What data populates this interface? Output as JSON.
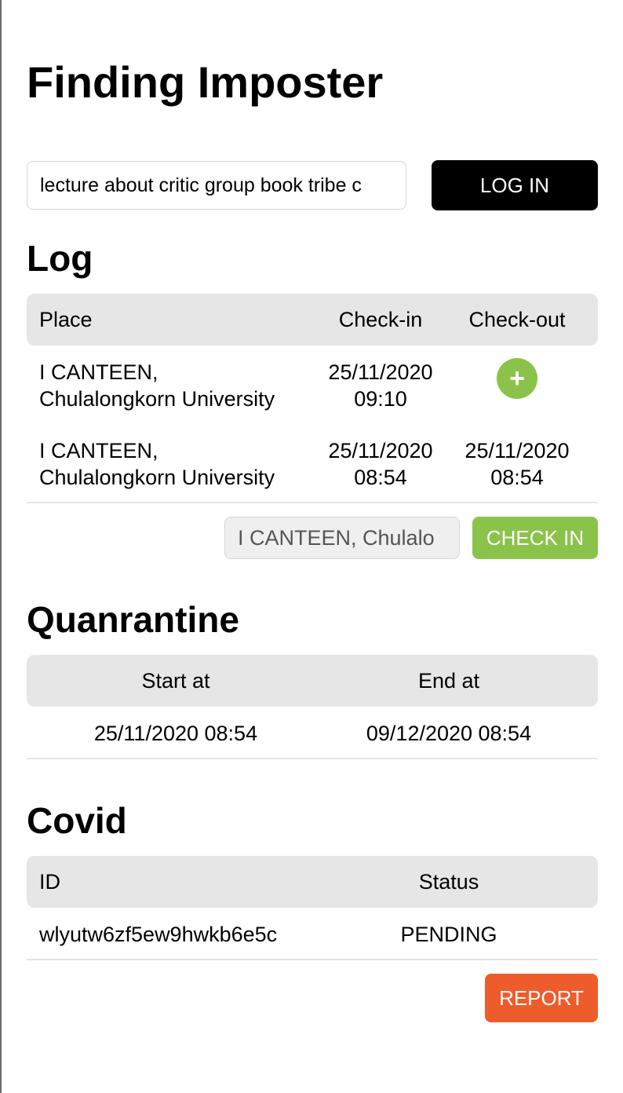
{
  "app": {
    "title": "Finding Imposter"
  },
  "login": {
    "token_value": "lecture about critic group book tribe c",
    "button_label": "LOG IN"
  },
  "log": {
    "title": "Log",
    "columns": [
      "Place",
      "Check-in",
      "Check-out"
    ],
    "rows": [
      {
        "place_line1": "I CANTEEN,",
        "place_line2": "Chulalongkorn University",
        "checkin_date": "25/11/2020",
        "checkin_time": "09:10",
        "checkout_action": "+"
      },
      {
        "place_line1": "I CANTEEN,",
        "place_line2": "Chulalongkorn University",
        "checkin_date": "25/11/2020",
        "checkin_time": "08:54",
        "checkout_date": "25/11/2020",
        "checkout_time": "08:54"
      }
    ],
    "place_input_value": "I CANTEEN, Chulalo",
    "checkin_button_label": "CHECK IN"
  },
  "quarantine": {
    "title": "Quanrantine",
    "columns": [
      "Start at",
      "End at"
    ],
    "rows": [
      {
        "start": "25/11/2020 08:54",
        "end": "09/12/2020 08:54"
      }
    ]
  },
  "covid": {
    "title": "Covid",
    "columns": [
      "ID",
      "Status"
    ],
    "rows": [
      {
        "id": "wlyutw6zf5ew9hwkb6e5c",
        "status": "PENDING"
      }
    ],
    "report_button_label": "REPORT"
  },
  "colors": {
    "accent_green": "#8bc34a",
    "report_orange": "#ee5c2c",
    "header_gray": "#e6e6e6",
    "login_black": "#000000"
  },
  "icons": {
    "add_checkout": "plus-icon"
  }
}
